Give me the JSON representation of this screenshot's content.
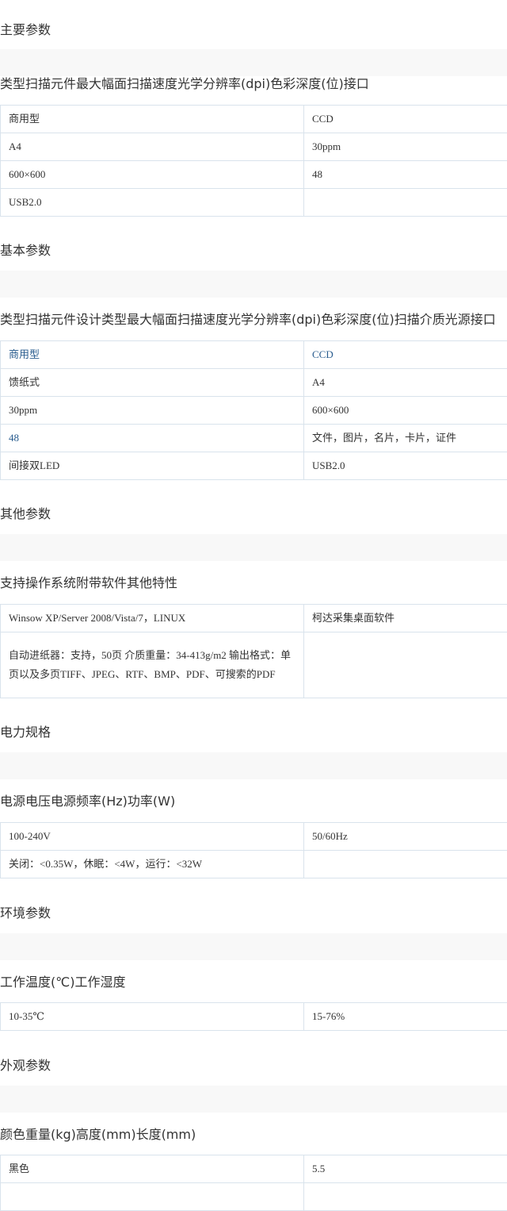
{
  "sections": {
    "main": {
      "title": "主要参数",
      "header": "类型扫描元件最大幅面扫描速度光学分辨率(dpi)色彩深度(位)接口",
      "rows": [
        [
          "商用型",
          "CCD"
        ],
        [
          "A4",
          "30ppm"
        ],
        [
          "600×600",
          "48"
        ],
        [
          "USB2.0",
          ""
        ]
      ]
    },
    "basic": {
      "title": "基本参数",
      "header": "类型扫描元件设计类型最大幅面扫描速度光学分辨率(dpi)色彩深度(位)扫描介质光源接口",
      "rows": [
        [
          "商用型",
          "CCD"
        ],
        [
          "馈纸式",
          "A4"
        ],
        [
          "30ppm",
          "600×600"
        ],
        [
          "48",
          "文件，图片，名片，卡片，证件"
        ],
        [
          "间接双LED",
          "USB2.0"
        ]
      ]
    },
    "other": {
      "title": "其他参数",
      "header": "支持操作系统附带软件其他特性",
      "rows": [
        [
          "Winsow XP/Server 2008/Vista/7，LINUX",
          "柯达采集桌面软件"
        ],
        [
          "自动进纸器：支持，50页 介质重量：34-413g/m2 输出格式：单页以及多页TIFF、JPEG、RTF、BMP、PDF、可搜索的PDF",
          ""
        ]
      ]
    },
    "power": {
      "title": "电力规格",
      "header": "电源电压电源频率(Hz)功率(W)",
      "rows": [
        [
          "100-240V",
          "50/60Hz"
        ],
        [
          "关闭：<0.35W，休眠：<4W，运行：<32W",
          ""
        ]
      ]
    },
    "env": {
      "title": "环境参数",
      "header": "工作温度(℃)工作湿度",
      "rows": [
        [
          "10-35℃",
          "15-76%"
        ]
      ]
    },
    "appearance": {
      "title": "外观参数",
      "header": "颜色重量(kg)高度(mm)长度(mm)",
      "rows": [
        [
          "黑色",
          "5.5"
        ],
        [
          "",
          ""
        ]
      ]
    }
  },
  "colors": {
    "text": "#333333",
    "link": "#2a5d8f",
    "border": "#d9e3ec",
    "band": "#f8f8f8"
  }
}
